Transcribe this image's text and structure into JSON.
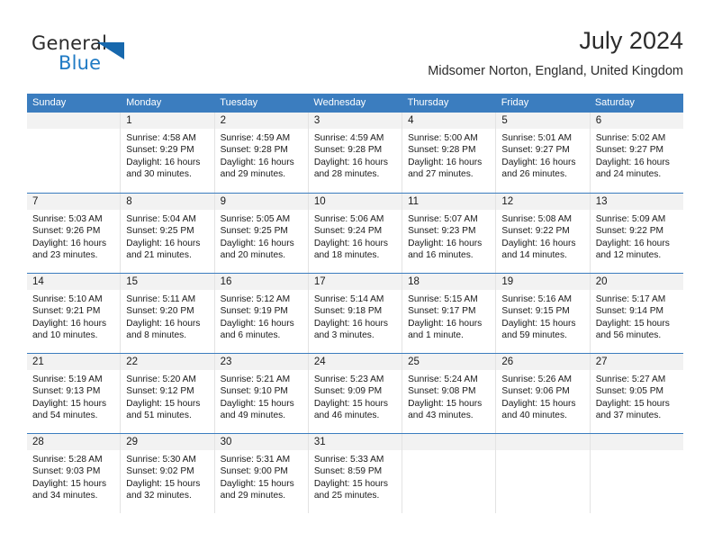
{
  "brand": {
    "name_top": "General",
    "name_bottom": "Blue",
    "triangle_icon": "triangle-icon",
    "accent_color": "#1768ad",
    "text_color": "#2b2b2b"
  },
  "header": {
    "title": "July 2024",
    "subtitle": "Midsomer Norton, England, United Kingdom"
  },
  "calendar": {
    "header_bg": "#3b7dbf",
    "day_band_bg": "#f2f2f2",
    "weekday_headers": [
      "Sunday",
      "Monday",
      "Tuesday",
      "Wednesday",
      "Thursday",
      "Friday",
      "Saturday"
    ],
    "weeks": [
      [
        {
          "day": "",
          "sunrise": "",
          "sunset": "",
          "daylight_1": "",
          "daylight_2": ""
        },
        {
          "day": "1",
          "sunrise": "Sunrise: 4:58 AM",
          "sunset": "Sunset: 9:29 PM",
          "daylight_1": "Daylight: 16 hours",
          "daylight_2": "and 30 minutes."
        },
        {
          "day": "2",
          "sunrise": "Sunrise: 4:59 AM",
          "sunset": "Sunset: 9:28 PM",
          "daylight_1": "Daylight: 16 hours",
          "daylight_2": "and 29 minutes."
        },
        {
          "day": "3",
          "sunrise": "Sunrise: 4:59 AM",
          "sunset": "Sunset: 9:28 PM",
          "daylight_1": "Daylight: 16 hours",
          "daylight_2": "and 28 minutes."
        },
        {
          "day": "4",
          "sunrise": "Sunrise: 5:00 AM",
          "sunset": "Sunset: 9:28 PM",
          "daylight_1": "Daylight: 16 hours",
          "daylight_2": "and 27 minutes."
        },
        {
          "day": "5",
          "sunrise": "Sunrise: 5:01 AM",
          "sunset": "Sunset: 9:27 PM",
          "daylight_1": "Daylight: 16 hours",
          "daylight_2": "and 26 minutes."
        },
        {
          "day": "6",
          "sunrise": "Sunrise: 5:02 AM",
          "sunset": "Sunset: 9:27 PM",
          "daylight_1": "Daylight: 16 hours",
          "daylight_2": "and 24 minutes."
        }
      ],
      [
        {
          "day": "7",
          "sunrise": "Sunrise: 5:03 AM",
          "sunset": "Sunset: 9:26 PM",
          "daylight_1": "Daylight: 16 hours",
          "daylight_2": "and 23 minutes."
        },
        {
          "day": "8",
          "sunrise": "Sunrise: 5:04 AM",
          "sunset": "Sunset: 9:25 PM",
          "daylight_1": "Daylight: 16 hours",
          "daylight_2": "and 21 minutes."
        },
        {
          "day": "9",
          "sunrise": "Sunrise: 5:05 AM",
          "sunset": "Sunset: 9:25 PM",
          "daylight_1": "Daylight: 16 hours",
          "daylight_2": "and 20 minutes."
        },
        {
          "day": "10",
          "sunrise": "Sunrise: 5:06 AM",
          "sunset": "Sunset: 9:24 PM",
          "daylight_1": "Daylight: 16 hours",
          "daylight_2": "and 18 minutes."
        },
        {
          "day": "11",
          "sunrise": "Sunrise: 5:07 AM",
          "sunset": "Sunset: 9:23 PM",
          "daylight_1": "Daylight: 16 hours",
          "daylight_2": "and 16 minutes."
        },
        {
          "day": "12",
          "sunrise": "Sunrise: 5:08 AM",
          "sunset": "Sunset: 9:22 PM",
          "daylight_1": "Daylight: 16 hours",
          "daylight_2": "and 14 minutes."
        },
        {
          "day": "13",
          "sunrise": "Sunrise: 5:09 AM",
          "sunset": "Sunset: 9:22 PM",
          "daylight_1": "Daylight: 16 hours",
          "daylight_2": "and 12 minutes."
        }
      ],
      [
        {
          "day": "14",
          "sunrise": "Sunrise: 5:10 AM",
          "sunset": "Sunset: 9:21 PM",
          "daylight_1": "Daylight: 16 hours",
          "daylight_2": "and 10 minutes."
        },
        {
          "day": "15",
          "sunrise": "Sunrise: 5:11 AM",
          "sunset": "Sunset: 9:20 PM",
          "daylight_1": "Daylight: 16 hours",
          "daylight_2": "and 8 minutes."
        },
        {
          "day": "16",
          "sunrise": "Sunrise: 5:12 AM",
          "sunset": "Sunset: 9:19 PM",
          "daylight_1": "Daylight: 16 hours",
          "daylight_2": "and 6 minutes."
        },
        {
          "day": "17",
          "sunrise": "Sunrise: 5:14 AM",
          "sunset": "Sunset: 9:18 PM",
          "daylight_1": "Daylight: 16 hours",
          "daylight_2": "and 3 minutes."
        },
        {
          "day": "18",
          "sunrise": "Sunrise: 5:15 AM",
          "sunset": "Sunset: 9:17 PM",
          "daylight_1": "Daylight: 16 hours",
          "daylight_2": "and 1 minute."
        },
        {
          "day": "19",
          "sunrise": "Sunrise: 5:16 AM",
          "sunset": "Sunset: 9:15 PM",
          "daylight_1": "Daylight: 15 hours",
          "daylight_2": "and 59 minutes."
        },
        {
          "day": "20",
          "sunrise": "Sunrise: 5:17 AM",
          "sunset": "Sunset: 9:14 PM",
          "daylight_1": "Daylight: 15 hours",
          "daylight_2": "and 56 minutes."
        }
      ],
      [
        {
          "day": "21",
          "sunrise": "Sunrise: 5:19 AM",
          "sunset": "Sunset: 9:13 PM",
          "daylight_1": "Daylight: 15 hours",
          "daylight_2": "and 54 minutes."
        },
        {
          "day": "22",
          "sunrise": "Sunrise: 5:20 AM",
          "sunset": "Sunset: 9:12 PM",
          "daylight_1": "Daylight: 15 hours",
          "daylight_2": "and 51 minutes."
        },
        {
          "day": "23",
          "sunrise": "Sunrise: 5:21 AM",
          "sunset": "Sunset: 9:10 PM",
          "daylight_1": "Daylight: 15 hours",
          "daylight_2": "and 49 minutes."
        },
        {
          "day": "24",
          "sunrise": "Sunrise: 5:23 AM",
          "sunset": "Sunset: 9:09 PM",
          "daylight_1": "Daylight: 15 hours",
          "daylight_2": "and 46 minutes."
        },
        {
          "day": "25",
          "sunrise": "Sunrise: 5:24 AM",
          "sunset": "Sunset: 9:08 PM",
          "daylight_1": "Daylight: 15 hours",
          "daylight_2": "and 43 minutes."
        },
        {
          "day": "26",
          "sunrise": "Sunrise: 5:26 AM",
          "sunset": "Sunset: 9:06 PM",
          "daylight_1": "Daylight: 15 hours",
          "daylight_2": "and 40 minutes."
        },
        {
          "day": "27",
          "sunrise": "Sunrise: 5:27 AM",
          "sunset": "Sunset: 9:05 PM",
          "daylight_1": "Daylight: 15 hours",
          "daylight_2": "and 37 minutes."
        }
      ],
      [
        {
          "day": "28",
          "sunrise": "Sunrise: 5:28 AM",
          "sunset": "Sunset: 9:03 PM",
          "daylight_1": "Daylight: 15 hours",
          "daylight_2": "and 34 minutes."
        },
        {
          "day": "29",
          "sunrise": "Sunrise: 5:30 AM",
          "sunset": "Sunset: 9:02 PM",
          "daylight_1": "Daylight: 15 hours",
          "daylight_2": "and 32 minutes."
        },
        {
          "day": "30",
          "sunrise": "Sunrise: 5:31 AM",
          "sunset": "Sunset: 9:00 PM",
          "daylight_1": "Daylight: 15 hours",
          "daylight_2": "and 29 minutes."
        },
        {
          "day": "31",
          "sunrise": "Sunrise: 5:33 AM",
          "sunset": "Sunset: 8:59 PM",
          "daylight_1": "Daylight: 15 hours",
          "daylight_2": "and 25 minutes."
        },
        {
          "day": "",
          "sunrise": "",
          "sunset": "",
          "daylight_1": "",
          "daylight_2": ""
        },
        {
          "day": "",
          "sunrise": "",
          "sunset": "",
          "daylight_1": "",
          "daylight_2": ""
        },
        {
          "day": "",
          "sunrise": "",
          "sunset": "",
          "daylight_1": "",
          "daylight_2": ""
        }
      ]
    ]
  }
}
